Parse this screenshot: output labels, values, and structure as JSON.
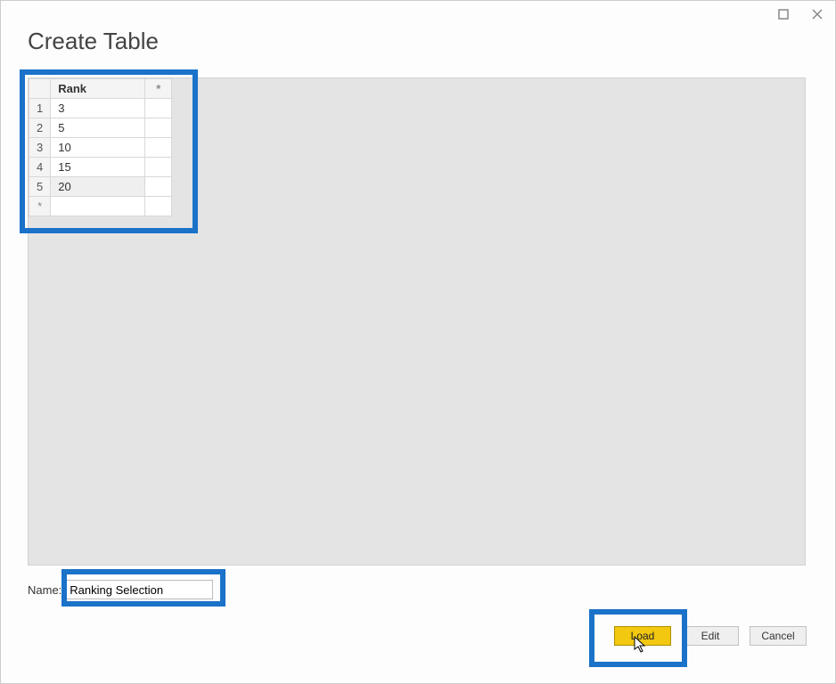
{
  "window": {
    "title": "Create Table"
  },
  "table": {
    "columns": {
      "rank": "Rank",
      "star": "*"
    },
    "rows": [
      {
        "idx": "1",
        "rank": "3"
      },
      {
        "idx": "2",
        "rank": "5"
      },
      {
        "idx": "3",
        "rank": "10"
      },
      {
        "idx": "4",
        "rank": "15"
      },
      {
        "idx": "5",
        "rank": "20"
      }
    ],
    "new_row_marker": "*"
  },
  "name_field": {
    "label": "Name:",
    "value": "Ranking Selection"
  },
  "buttons": {
    "load": "Load",
    "edit": "Edit",
    "cancel": "Cancel"
  }
}
